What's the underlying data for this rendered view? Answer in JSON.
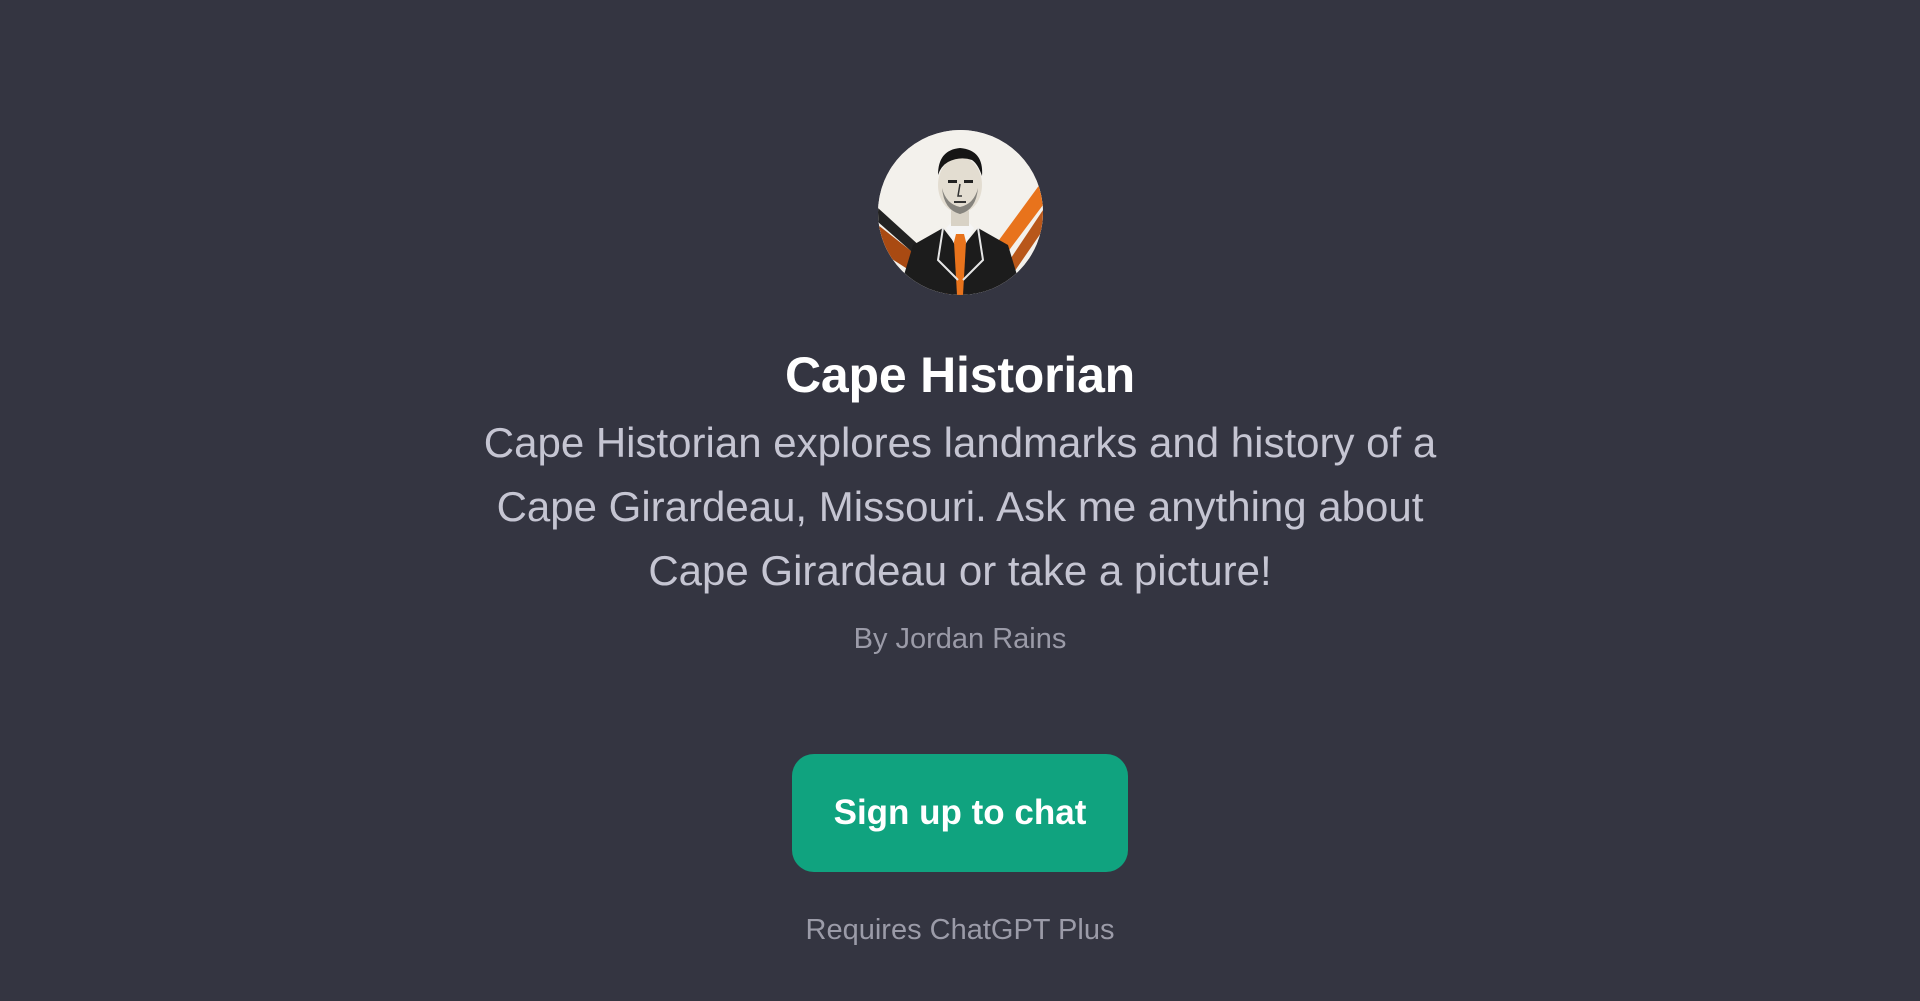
{
  "gpt": {
    "avatar_icon": "historian-portrait-avatar",
    "title": "Cape Historian",
    "description": "Cape Historian explores landmarks and history of a Cape Girardeau, Missouri. Ask me anything about Cape Girardeau or take a picture!",
    "author": "By Jordan Rains"
  },
  "cta": {
    "signup_label": "Sign up to chat",
    "requires_label": "Requires ChatGPT Plus"
  },
  "colors": {
    "background": "#343541",
    "button": "#10a37f",
    "title": "#ffffff",
    "description": "#c5c5d2",
    "muted": "#9b9ba8",
    "avatar_accent": "#e8731c"
  }
}
